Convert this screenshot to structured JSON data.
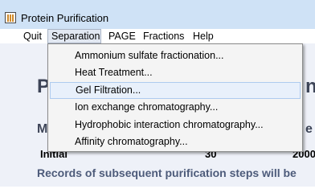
{
  "window": {
    "title": "Protein Purification"
  },
  "menubar": {
    "items": [
      {
        "label": "Quit"
      },
      {
        "label": "Separation"
      },
      {
        "label": "PAGE"
      },
      {
        "label": "Fractions"
      },
      {
        "label": "Help"
      }
    ],
    "active": "Separation"
  },
  "separation_menu": {
    "items": [
      {
        "label": "Ammonium sulfate fractionation..."
      },
      {
        "label": "Heat Treatment..."
      },
      {
        "label": "Gel Filtration..."
      },
      {
        "label": "Ion exchange chromatography..."
      },
      {
        "label": "Hydrophobic interaction chromatography..."
      },
      {
        "label": "Affinity chromatography..."
      }
    ],
    "highlighted": "Gel Filtration..."
  },
  "background": {
    "heading_fragment": "P",
    "heading_fragment_right": "n",
    "sub_fragment_left": "M",
    "sub_fragment_right": "e",
    "row_label": "Initial",
    "row_value": "30",
    "row_value_right": "2000",
    "records_text": "Records of subsequent purification steps will be"
  }
}
